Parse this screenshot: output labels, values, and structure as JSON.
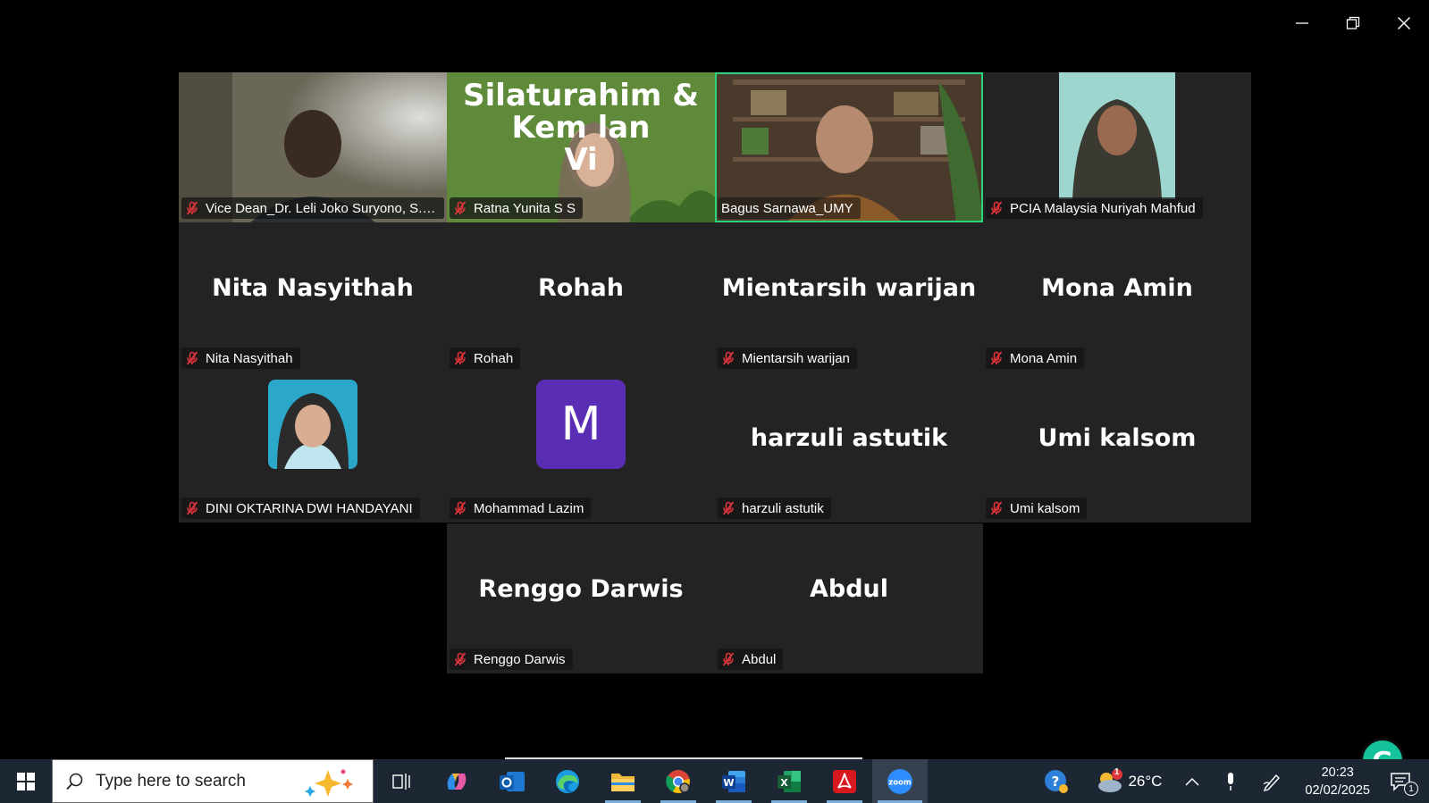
{
  "window": {
    "minimize_icon": "minimize-icon",
    "restore_icon": "restore-icon",
    "close_icon": "close-icon"
  },
  "participants": [
    {
      "label": "Vice Dean_Dr. Leli Joko Suryono, S.H....",
      "display": "video"
    },
    {
      "label": "Ratna Yunita S S",
      "display": "video",
      "background_text": [
        "Silaturahim &",
        "Kem lan",
        "Vi"
      ]
    },
    {
      "label": "Bagus Sarnawa_UMY",
      "display": "video",
      "active_speaker": true
    },
    {
      "label": "PCIA Malaysia Nuriyah Mahfud",
      "display": "video"
    },
    {
      "label": "Nita Nasyithah",
      "display": "name",
      "name": "Nita Nasyithah"
    },
    {
      "label": "Rohah",
      "display": "name",
      "name": "Rohah"
    },
    {
      "label": "Mientarsih warijan",
      "display": "name",
      "name": "Mientarsih warijan"
    },
    {
      "label": "Mona Amin",
      "display": "name",
      "name": "Mona Amin"
    },
    {
      "label": "DINI OKTARINA DWI HANDAYANI",
      "display": "photo"
    },
    {
      "label": "Mohammad Lazim",
      "display": "letter",
      "letter": "M"
    },
    {
      "label": "harzuli astutik",
      "display": "name",
      "name": "harzuli astutik"
    },
    {
      "label": "Umi kalsom",
      "display": "name",
      "name": "Umi kalsom"
    },
    {
      "label": "Renggo Darwis",
      "display": "name",
      "name": "Renggo Darwis"
    },
    {
      "label": "Abdul",
      "display": "name",
      "name": "Abdul"
    }
  ],
  "taskbar": {
    "search_placeholder": "Type here to search",
    "apps": [
      "task-view",
      "copilot",
      "outlook",
      "edge",
      "file-explorer",
      "chrome",
      "word",
      "excel",
      "acrobat",
      "zoom"
    ],
    "zoom_label": "zoom",
    "weather_temp": "26°C",
    "weather_badge": "1",
    "time": "20:23",
    "date": "02/02/2025",
    "notification_count": "1"
  },
  "colors": {
    "active_speaker": "#2bd47b",
    "tile_bg": "#232323",
    "taskbar_bg": "#1d2733",
    "avatar_purple": "#5a2db5",
    "muted_red": "#e0353b"
  }
}
